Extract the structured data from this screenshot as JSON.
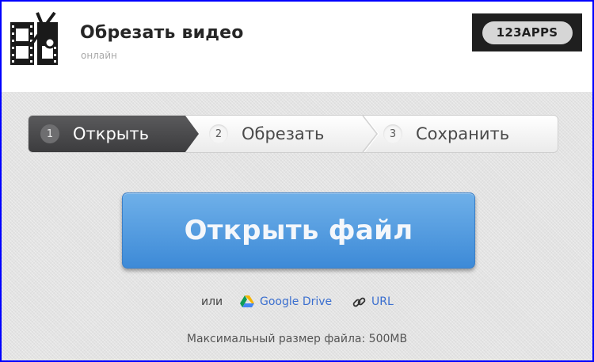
{
  "header": {
    "title": "Обрезать видео",
    "subtitle": "онлайн",
    "brand": "123APPS",
    "logo_icon": "film-scissors-icon"
  },
  "steps": [
    {
      "number": "1",
      "label": "Открыть",
      "state": "active"
    },
    {
      "number": "2",
      "label": "Обрезать",
      "state": "idle"
    },
    {
      "number": "3",
      "label": "Сохранить",
      "state": "idle"
    }
  ],
  "open_button": {
    "label": "Открыть файл"
  },
  "alternatives": {
    "or_text": "или",
    "google_drive": {
      "label": "Google Drive",
      "icon": "google-drive-icon"
    },
    "url": {
      "label": "URL",
      "icon": "link-icon"
    }
  },
  "max_size_text": "Максимальный размер файла: 500MB",
  "colors": {
    "frame_border": "#0000ff",
    "button_top": "#6fb0e9",
    "button_bottom": "#3d8ad7",
    "active_step": "#49494b",
    "link": "#3b6fcf"
  }
}
